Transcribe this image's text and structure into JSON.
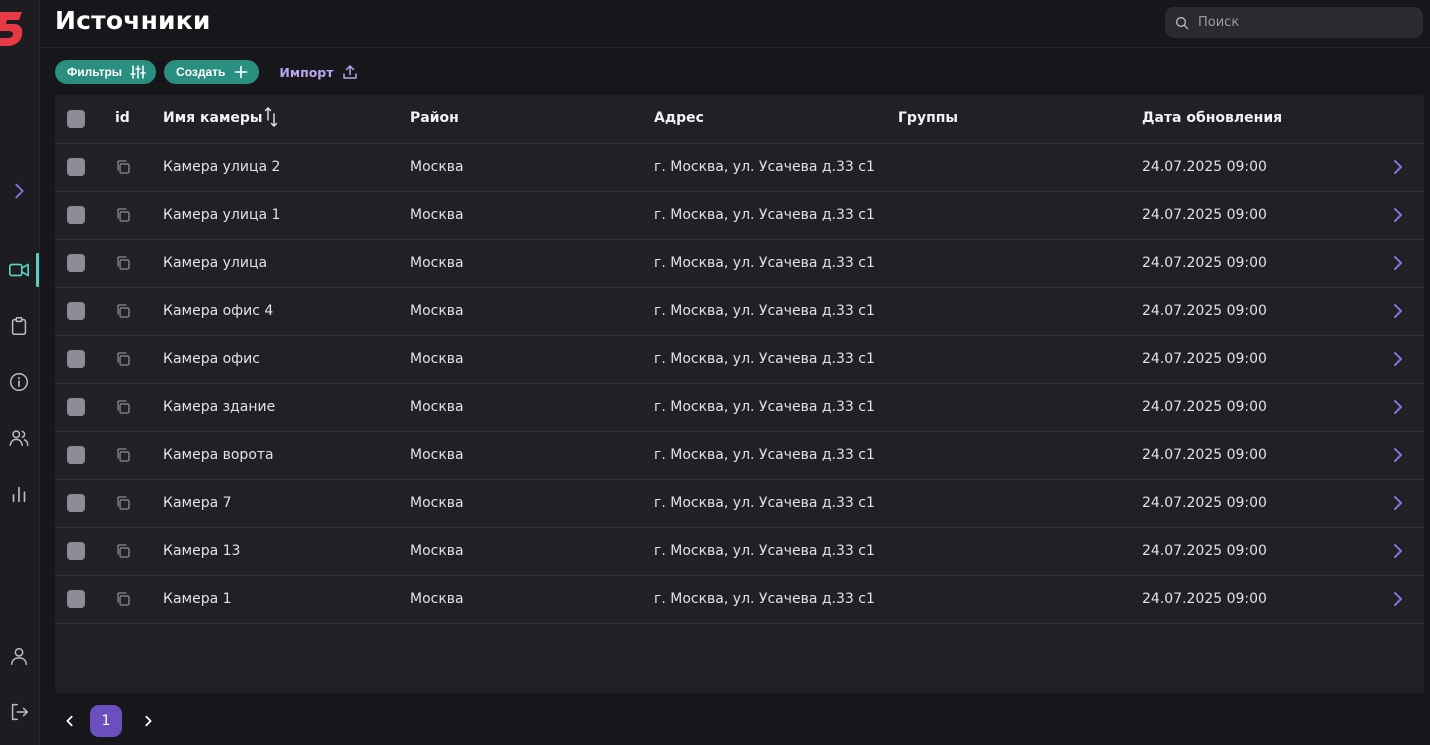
{
  "header": {
    "title": "Источники",
    "search_placeholder": "Поиск"
  },
  "toolbar": {
    "filters_label": "Фильтры",
    "create_label": "Создать",
    "import_label": "Импорт"
  },
  "colors": {
    "accent_teal": "#2a8f80",
    "accent_purple": "#6a4fc0",
    "brand_red": "#e53946",
    "import_text": "#b8a4f0"
  },
  "icons": {
    "sidebar": [
      "expand-chevron-icon",
      "video-camera-icon",
      "clipboard-icon",
      "info-icon",
      "users-icon",
      "bar-chart-icon",
      "user-profile-icon",
      "logout-icon"
    ],
    "active_sidebar_item": "video-camera-icon"
  },
  "table": {
    "columns": [
      "id",
      "Имя камеры",
      "Район",
      "Адрес",
      "Группы",
      "Дата обновления"
    ],
    "rows": [
      {
        "name": "Камера улица 2",
        "district": "Москва",
        "address": "г. Москва, ул. Усачева д.33 с1",
        "groups": "",
        "updated": "24.07.2025 09:00"
      },
      {
        "name": "Камера улица 1",
        "district": "Москва",
        "address": "г. Москва, ул. Усачева д.33 с1",
        "groups": "",
        "updated": "24.07.2025 09:00"
      },
      {
        "name": "Камера улица",
        "district": "Москва",
        "address": "г. Москва, ул. Усачева д.33 с1",
        "groups": "",
        "updated": "24.07.2025 09:00"
      },
      {
        "name": "Камера офис 4",
        "district": "Москва",
        "address": "г. Москва, ул. Усачева д.33 с1",
        "groups": "",
        "updated": "24.07.2025 09:00"
      },
      {
        "name": "Камера офис",
        "district": "Москва",
        "address": "г. Москва, ул. Усачева д.33 с1",
        "groups": "",
        "updated": "24.07.2025 09:00"
      },
      {
        "name": "Камера здание",
        "district": "Москва",
        "address": "г. Москва, ул. Усачева д.33 с1",
        "groups": "",
        "updated": "24.07.2025 09:00"
      },
      {
        "name": "Камера ворота",
        "district": "Москва",
        "address": "г. Москва, ул. Усачева д.33 с1",
        "groups": "",
        "updated": "24.07.2025 09:00"
      },
      {
        "name": "Камера 7",
        "district": "Москва",
        "address": "г. Москва, ул. Усачева д.33 с1",
        "groups": "",
        "updated": "24.07.2025 09:00"
      },
      {
        "name": "Камера 13",
        "district": "Москва",
        "address": "г. Москва, ул. Усачева д.33 с1",
        "groups": "",
        "updated": "24.07.2025 09:00"
      },
      {
        "name": "Камера 1",
        "district": "Москва",
        "address": "г. Москва, ул. Усачева д.33 с1",
        "groups": "",
        "updated": "24.07.2025 09:00"
      }
    ]
  },
  "pagination": {
    "current_page": "1"
  }
}
